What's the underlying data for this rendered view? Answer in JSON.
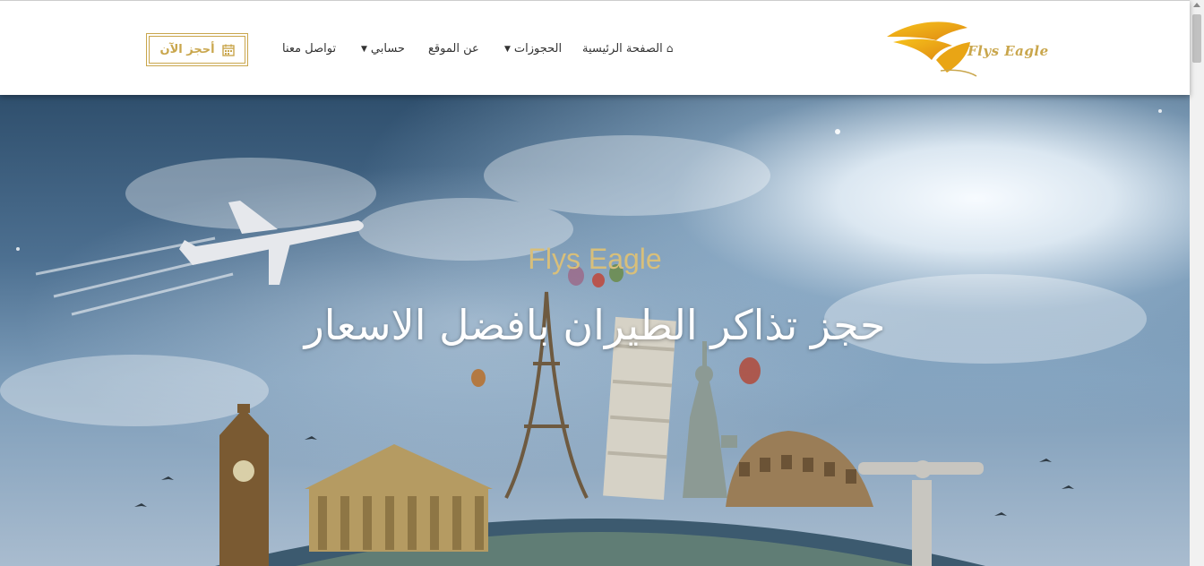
{
  "brand": {
    "logo_text": "Flys Eagle"
  },
  "nav": {
    "home": "الصفحة الرئيسية",
    "bookings": "الحجوزات",
    "about": "عن الموقع",
    "account": "حسابي",
    "contact": "تواصل معنا",
    "book_now": "أحجز الآن"
  },
  "hero": {
    "subtitle": "Flys Eagle",
    "title": "حجز تذاكر الطيران بافضل الاسعار"
  },
  "colors": {
    "accent": "#c9a64c",
    "subtitle": "#d8bf7a"
  }
}
